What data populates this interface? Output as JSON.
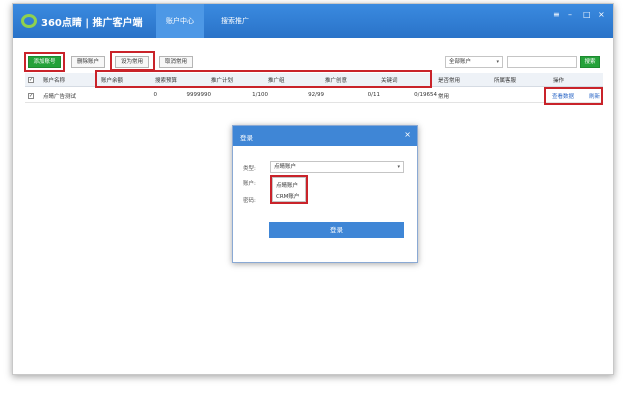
{
  "app": {
    "brand": "360点睛 | 推广客户端",
    "tabs": [
      {
        "label": "账户中心",
        "active": true
      },
      {
        "label": "搜索推广",
        "active": false
      }
    ],
    "window_controls": [
      "≡",
      "–",
      "□",
      "×"
    ]
  },
  "toolbar": {
    "add_account": "添加账号",
    "delete_account": "删除账户",
    "set_common": "设为常用",
    "cancel_common": "取消常用",
    "filter_selected": "全部账户",
    "search_placeholder": "",
    "search_button": "搜索"
  },
  "table": {
    "headers": [
      "账户名称",
      "账户余额",
      "搜索预算",
      "推广计划",
      "推广组",
      "推广创意",
      "关键词",
      "是否常用",
      "所属客服",
      "操作"
    ],
    "rows": [
      {
        "checked": true,
        "name": "点睛广告测试",
        "balance": "0",
        "budget": "9999990",
        "plans": "1/100",
        "groups": "92/99",
        "creatives": "0/11",
        "keywords": "0/19654",
        "common": "常用",
        "service": "",
        "action_view": "查看数据",
        "action_refresh": "刷新"
      }
    ]
  },
  "login_dialog": {
    "title": "登录",
    "type_label": "类型:",
    "type_value": "点睛账户",
    "account_label": "账户:",
    "password_label": "密码:",
    "options": [
      "点睛账户",
      "CRM账户"
    ],
    "login_button": "登录"
  },
  "colors": {
    "titlebar": "#2f7fd3",
    "accent_green": "#24a23a",
    "highlight_red": "#c9232a",
    "link": "#2a66c6"
  }
}
